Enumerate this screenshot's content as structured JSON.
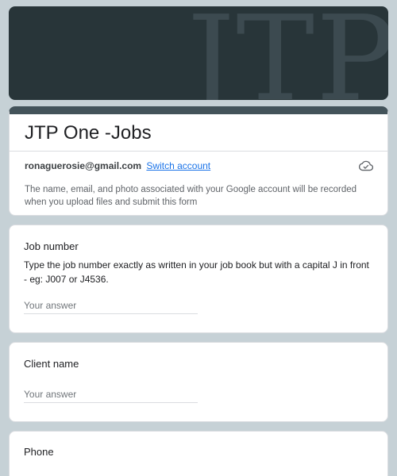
{
  "banner": {
    "logo_text": "JTP"
  },
  "header": {
    "title": "JTP One -Jobs",
    "account_email": "ronaguerosie@gmail.com",
    "switch_account_label": "Switch account",
    "cloud_icon": "cloud-check-icon",
    "notice": "The name, email, and photo associated with your Google account will be recorded when you upload files and submit this form"
  },
  "questions": [
    {
      "title": "Job number",
      "description": "Type the job number exactly as written in your job book but with a capital J in front - eg: J007 or J4536.",
      "placeholder": "Your answer"
    },
    {
      "title": "Client name",
      "placeholder": "Your answer"
    },
    {
      "title": "Phone"
    }
  ],
  "colors": {
    "background": "#c6d1d6",
    "banner": "#283539",
    "accent": "#43535a",
    "link": "#1a73e8"
  }
}
